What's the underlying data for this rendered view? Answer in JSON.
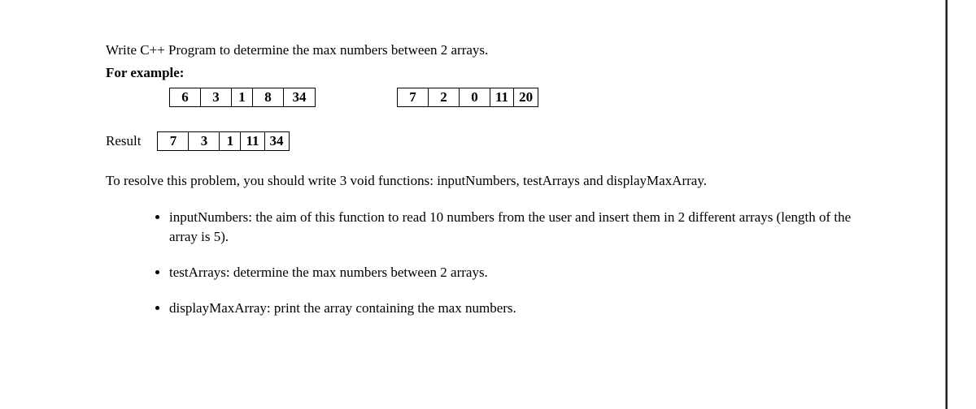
{
  "intro": "Write C++ Program to determine the max numbers between 2 arrays.",
  "for_example": "For example:",
  "arrays": {
    "a": [
      "6",
      "3",
      "1",
      "8",
      "34"
    ],
    "b": [
      "7",
      "2",
      "0",
      "11",
      "20"
    ],
    "result": [
      "7",
      "3",
      "1",
      "11",
      "34"
    ]
  },
  "result_label": "Result",
  "desc": "To resolve this problem, you should write 3 void functions: inputNumbers, testArrays and displayMaxArray.",
  "bullets": [
    "inputNumbers: the aim of this function to read 10 numbers from the user and insert them in 2 different arrays (length of the array is 5).",
    "testArrays: determine the max numbers between 2 arrays.",
    "displayMaxArray: print the array containing the max numbers."
  ]
}
